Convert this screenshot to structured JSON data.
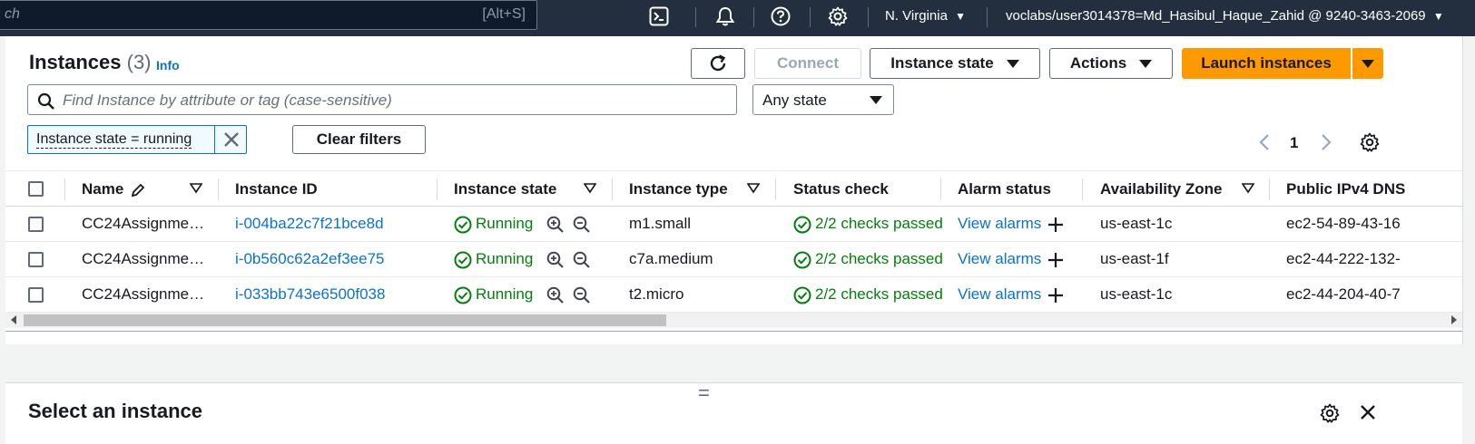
{
  "topbar": {
    "search_placeholder": "ch",
    "search_shortcut": "[Alt+S]",
    "region": "N. Virginia",
    "account": "voclabs/user3014378=Md_Hasibul_Haque_Zahid @ 9240-3463-2069",
    "icons": [
      "cloudshell-icon",
      "bell-icon",
      "help-icon",
      "settings-icon"
    ]
  },
  "header": {
    "title": "Instances",
    "count": "(3)",
    "info": "Info",
    "connect": "Connect",
    "instance_state": "Instance state",
    "actions": "Actions",
    "launch": "Launch instances"
  },
  "filters": {
    "search_placeholder": "Find Instance by attribute or tag (case-sensitive)",
    "state_select": "Any state",
    "token": "Instance state = running",
    "clear": "Clear filters"
  },
  "pagination": {
    "page": "1"
  },
  "table": {
    "columns": [
      "Name",
      "Instance ID",
      "Instance state",
      "Instance type",
      "Status check",
      "Alarm status",
      "Availability Zone",
      "Public IPv4 DNS"
    ],
    "rows": [
      {
        "name": "CC24Assignme…",
        "id": "i-004ba22c7f21bce8d",
        "state": "Running",
        "type": "m1.small",
        "status": "2/2 checks passed",
        "alarm": "View alarms",
        "az": "us-east-1c",
        "dns": "ec2-54-89-43-16"
      },
      {
        "name": "CC24Assignme…",
        "id": "i-0b560c62a2ef3ee75",
        "state": "Running",
        "type": "c7a.medium",
        "status": "2/2 checks passed",
        "alarm": "View alarms",
        "az": "us-east-1f",
        "dns": "ec2-44-222-132-"
      },
      {
        "name": "CC24Assignme…",
        "id": "i-033bb743e6500f038",
        "state": "Running",
        "type": "t2.micro",
        "status": "2/2 checks passed",
        "alarm": "View alarms",
        "az": "us-east-1c",
        "dns": "ec2-44-204-40-7"
      }
    ]
  },
  "split_panel": {
    "handle": "=",
    "title": "Select an instance"
  },
  "colors": {
    "topbar": "#232f3e",
    "link": "#0972d3",
    "success": "#037f0c",
    "primary": "#ff9900"
  }
}
